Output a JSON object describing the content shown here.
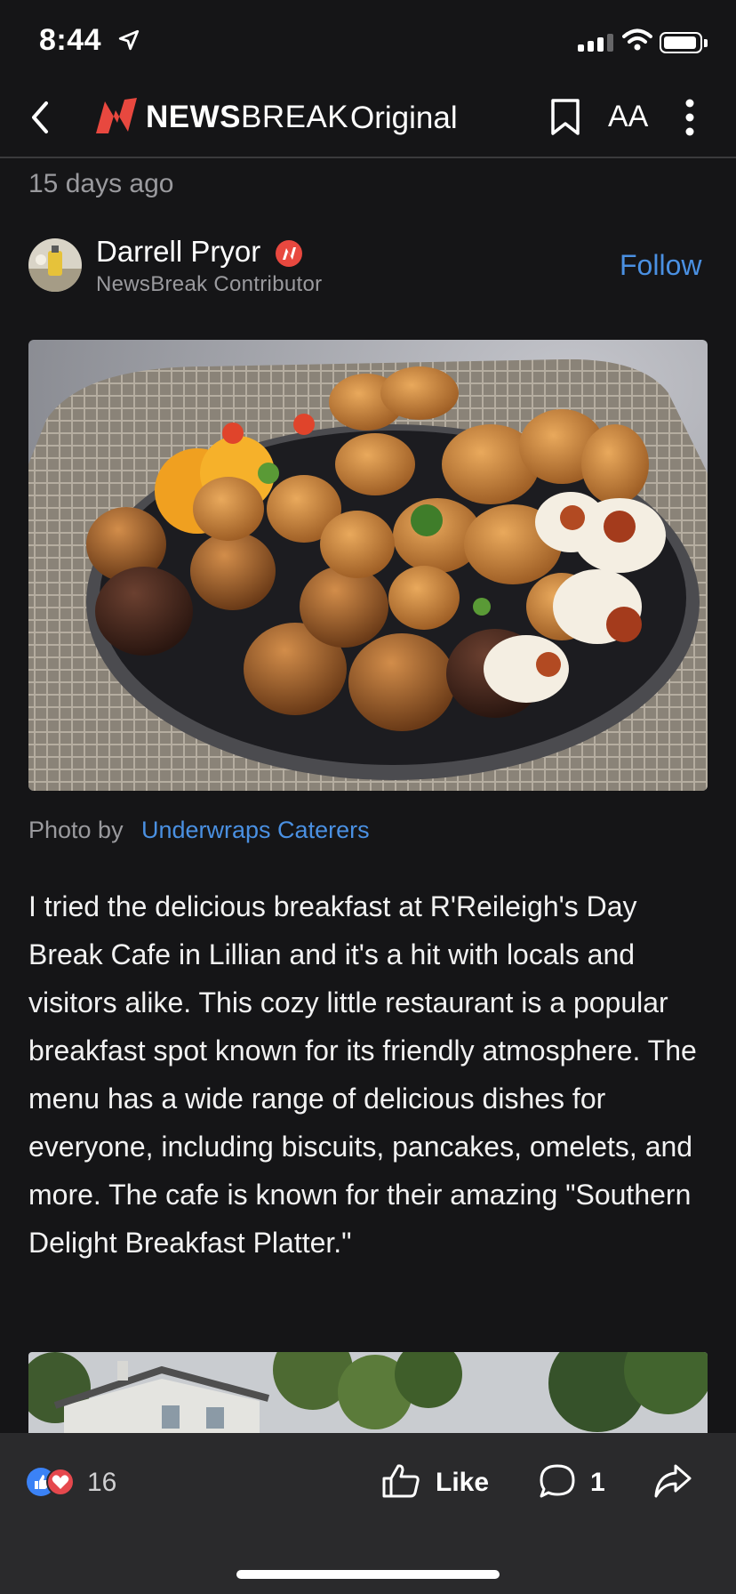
{
  "status_bar": {
    "time": "8:44"
  },
  "nav": {
    "brand_bold": "NEWS",
    "brand_regular": "BREAK",
    "brand_suffix": "Original",
    "font_button": "AA"
  },
  "article": {
    "time_ago": "15 days ago",
    "author": {
      "name": "Darrell Pryor",
      "role": "NewsBreak Contributor"
    },
    "follow_label": "Follow",
    "photo_caption": {
      "label": "Photo by",
      "credit": "Underwraps Caterers"
    },
    "body": "I tried the delicious breakfast at R'Reileigh's Day Break Cafe in Lillian and it's a hit with locals and visitors alike. This cozy little restaurant is a popular breakfast spot known for its friendly atmosphere. The menu has a wide range of delicious dishes for everyone, including biscuits, pancakes, omelets, and more. The cafe is known for their amazing \"Southern Delight Breakfast Platter.\""
  },
  "bottom_bar": {
    "reaction_count": "16",
    "like_label": "Like",
    "comment_count": "1"
  },
  "colors": {
    "background": "#151517",
    "accent": "#4a90e2",
    "brand_red": "#e8483f",
    "bottom_bar": "#2a2a2c"
  }
}
